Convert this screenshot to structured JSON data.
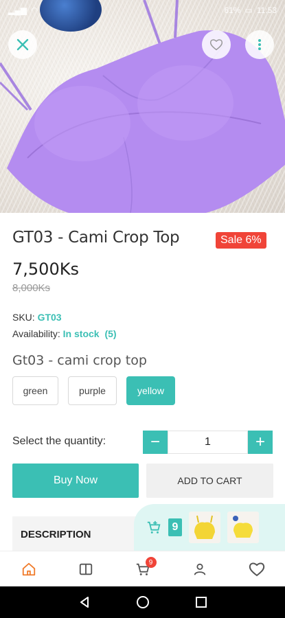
{
  "status_bar": {
    "time": "11:53",
    "battery": "61%"
  },
  "product": {
    "title": "GT03 - Cami Crop Top",
    "sale_badge": "Sale 6%",
    "price": "7,500Ks",
    "old_price": "8,000Ks",
    "sku_label": "SKU:",
    "sku_value": "GT03",
    "availability_label": "Availability:",
    "availability_value": "In stock",
    "stock_count": "(5)",
    "variant_title": "Gt03 - cami crop top",
    "variants": [
      "green",
      "purple",
      "yellow"
    ],
    "selected_variant": "yellow"
  },
  "quantity": {
    "label": "Select the quantity:",
    "value": "1",
    "minus": "−",
    "plus": "+"
  },
  "actions": {
    "buy_now": "Buy Now",
    "add_to_cart": "ADD TO CART"
  },
  "description": {
    "label": "DESCRIPTION"
  },
  "mini_cart": {
    "count": "9"
  },
  "bottom_nav": {
    "cart_badge": "9"
  },
  "colors": {
    "accent": "#3bbfb4",
    "sale": "#f04438",
    "product": "#b48cf0"
  }
}
